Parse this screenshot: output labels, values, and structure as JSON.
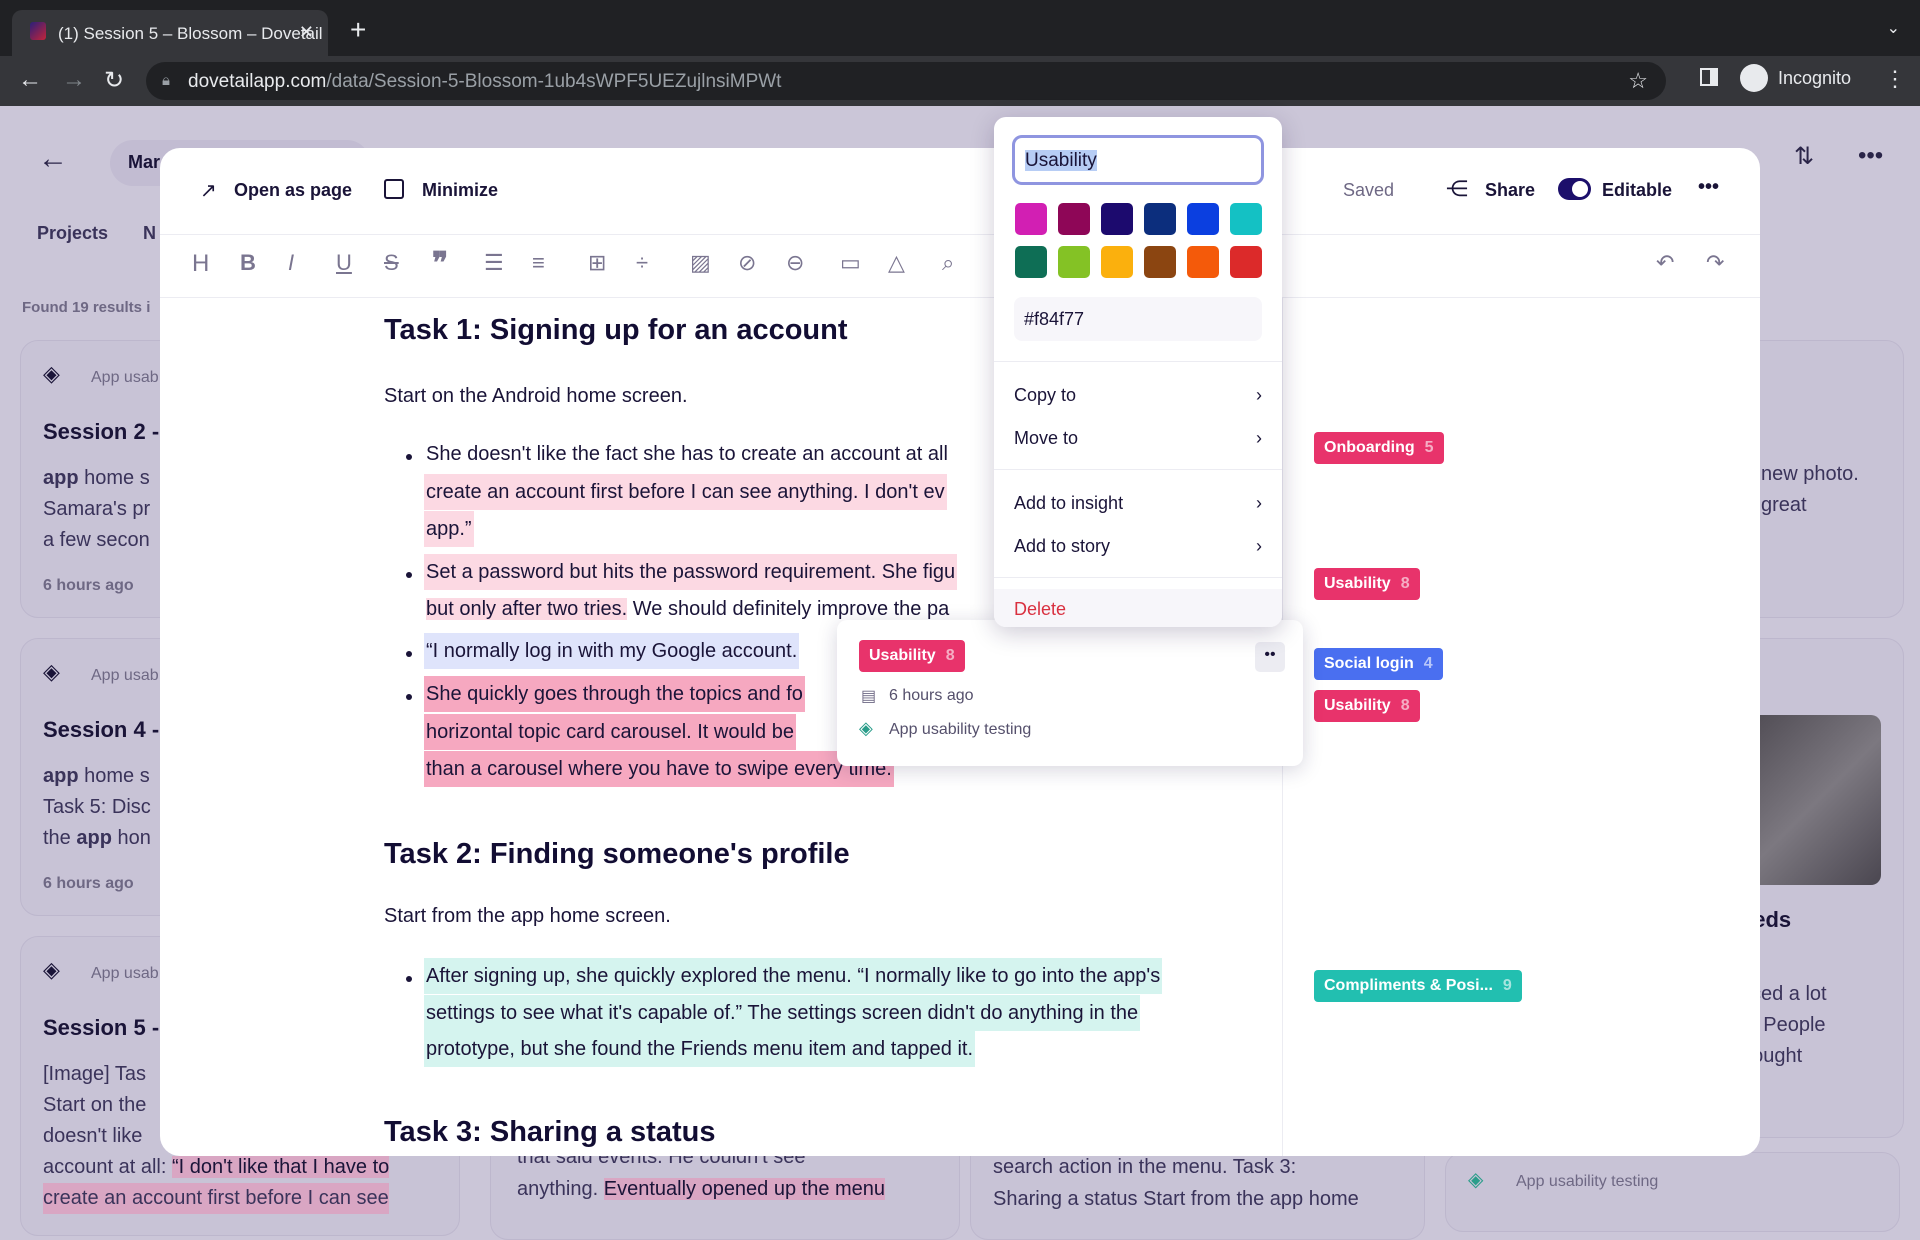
{
  "browser": {
    "tab_title": "(1) Session 5 – Blossom – Dovetail",
    "url_host": "dovetailapp.com",
    "url_path": "/data/Session-5-Blossom-1ub4sWPF5UEZujlnsiMPWt",
    "profile": "Incognito"
  },
  "background": {
    "breadcrumb": "Mar",
    "nav": [
      "Projects",
      "N"
    ],
    "results": "Found 19 results i",
    "cards": [
      {
        "project": "App usab",
        "title": "Session 2 -",
        "lines": [
          [
            "app",
            " home s"
          ],
          [
            "",
            "Samara's pr"
          ],
          [
            "",
            "a few secon"
          ]
        ],
        "time": "6 hours ago"
      },
      {
        "project": "App usab",
        "title": "Session 4 -",
        "lines": [
          [
            "app",
            " home s"
          ],
          [
            "",
            "Task 5: Disc"
          ],
          [
            "the ",
            "app",
            " hon"
          ]
        ],
        "time": "6 hours ago"
      },
      {
        "project": "App usab",
        "title": "Session 5 -",
        "lines": [
          "[Image] Tas",
          "Start on the",
          "doesn't like",
          "account at all:",
          "“I don't like that I have to",
          "create an account first before I can see"
        ]
      }
    ],
    "right_card": {
      "lines": [
        "new photo.",
        "great"
      ],
      "heading": "eeds",
      "lines2": [
        "ticed a lot",
        "n. People",
        "hought"
      ]
    },
    "bottom": {
      "col2": [
        "that said events. He couldn't see",
        "anything.",
        "Eventually opened up the menu"
      ],
      "col3": [
        "search action in the menu. Task 3:",
        "Sharing a status Start from the app home"
      ],
      "col4": "App usability testing"
    }
  },
  "modal": {
    "open_as_page": "Open as page",
    "minimize": "Minimize",
    "status": "Saved",
    "share": "Share",
    "editable_label": "Editable",
    "editable_on": true,
    "document": {
      "task1_heading": "Task 1: Signing up for an account",
      "task1_intro": "Start on the Android home screen.",
      "task1_lines": [
        "She doesn't like the fact she has to create an account at all",
        "create an account first before I can see anything. I don't ev",
        "app.”",
        "Set a password but hits the password requirement. She figu",
        "but only after two tries.",
        " We should definitely improve the pa",
        "“I normally log in with my Google account.",
        "She quickly goes through the topics and fo",
        "horizontal topic card carousel. It would be",
        "than a carousel where you have to swipe every time."
      ],
      "task2_heading": "Task 2: Finding someone's profile",
      "task2_intro": "Start from the app home screen.",
      "task2_lines": [
        "After signing up, she quickly explored the menu. “I normally like to go into the app's",
        "settings to see what it's capable of.” The settings screen didn't do anything in the",
        "prototype, but she found the Friends menu item and tapped it."
      ],
      "task3_heading": "Task 3: Sharing a status"
    },
    "tags": [
      {
        "label": "Onboarding",
        "count": "5",
        "color": "#e8336b"
      },
      {
        "label": "Usability",
        "count": "8",
        "color": "#e8336b"
      },
      {
        "label": "Social login",
        "count": "4",
        "color": "#4a6ff0"
      },
      {
        "label": "Usability",
        "count": "8",
        "color": "#e8336b"
      },
      {
        "label": "Compliments & Posi...",
        "count": "9",
        "color": "#22bfb0"
      }
    ]
  },
  "popover": {
    "tag_name": "Usability",
    "swatches": [
      "#d21fb3",
      "#8e0657",
      "#1c0a6e",
      "#0c2e7d",
      "#0b3fe0",
      "#14c1c4",
      "#0e6e55",
      "#84c225",
      "#fbb00d",
      "#8b4511",
      "#f45a0a",
      "#dc2a2a"
    ],
    "hex": "#f84f77",
    "menu": [
      "Copy to",
      "Move to",
      "Add to insight",
      "Add to story"
    ],
    "delete": "Delete"
  },
  "hover_card": {
    "tag": "Usability",
    "count": "8",
    "time": "6 hours ago",
    "project": "App usability testing"
  }
}
